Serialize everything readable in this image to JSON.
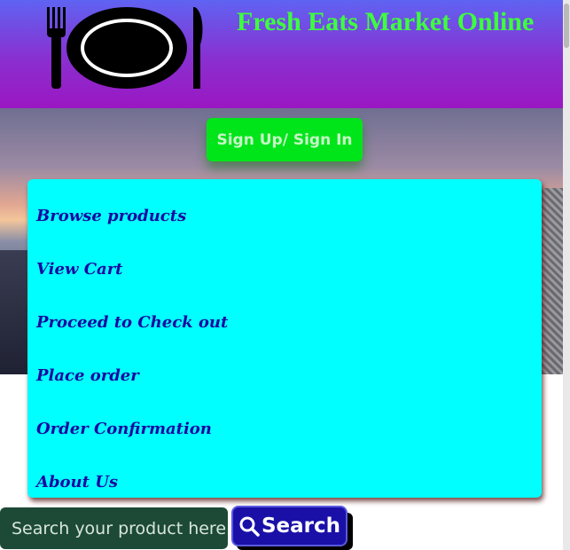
{
  "header": {
    "title": "Fresh Eats Market Online",
    "logo_icon": "plate-fork-knife-icon"
  },
  "hero": {
    "signup_label": "Sign Up/ Sign In"
  },
  "nav": {
    "items": [
      {
        "label": "Browse products"
      },
      {
        "label": "View Cart"
      },
      {
        "label": "Proceed to Check out"
      },
      {
        "label": "Place order"
      },
      {
        "label": "Order Confirmation"
      },
      {
        "label": "About Us"
      }
    ]
  },
  "search": {
    "placeholder": "Search your product here",
    "button_label": "Search",
    "icon": "search-icon"
  },
  "colors": {
    "header_gradient_top": "#5f63f2",
    "header_gradient_bottom": "#9b17c2",
    "title_color": "#3dff3d",
    "signup_bg": "#00e51a",
    "nav_panel_bg": "#00ffff",
    "nav_text": "#1a0aa0",
    "search_input_bg": "#1d4a36",
    "search_button_bg": "#1a10a8"
  }
}
